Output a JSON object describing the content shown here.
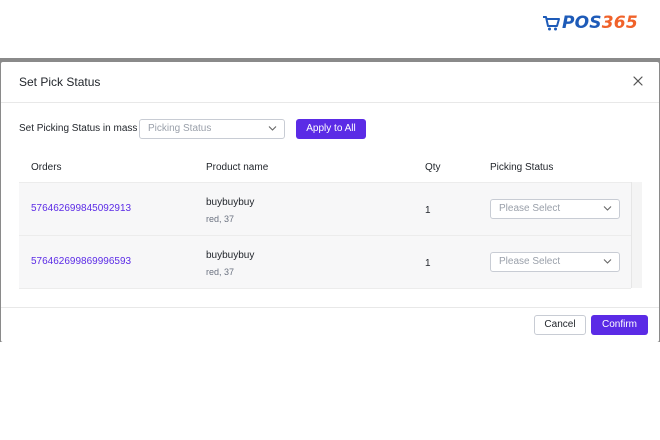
{
  "brand": {
    "logo_pos": "POS",
    "logo_365": "365",
    "pos_color": "#1e5bb8",
    "accent_365_color": "#f0622a",
    "icon": "shopping-cart-icon"
  },
  "modal": {
    "title": "Set Pick Status",
    "close_icon": "close-icon"
  },
  "mass_update": {
    "label": "Set Picking Status in mass :",
    "select_placeholder": "Picking Status",
    "apply_label": "Apply to All"
  },
  "table": {
    "columns": [
      "Orders",
      "Product name",
      "Qty",
      "Picking Status"
    ],
    "rows": [
      {
        "order_id": "576462699845092913",
        "product_name": "buybuybuy",
        "variant": "red, 37",
        "qty": "1",
        "status_placeholder": "Please Select"
      },
      {
        "order_id": "576462699869996593",
        "product_name": "buybuybuy",
        "variant": "red, 37",
        "qty": "1",
        "status_placeholder": "Please Select"
      }
    ]
  },
  "footer": {
    "cancel_label": "Cancel",
    "confirm_label": "Confirm"
  },
  "colors": {
    "primary": "#5b2be6",
    "link": "#5b2be6",
    "backdrop": "#8a8a8a"
  }
}
